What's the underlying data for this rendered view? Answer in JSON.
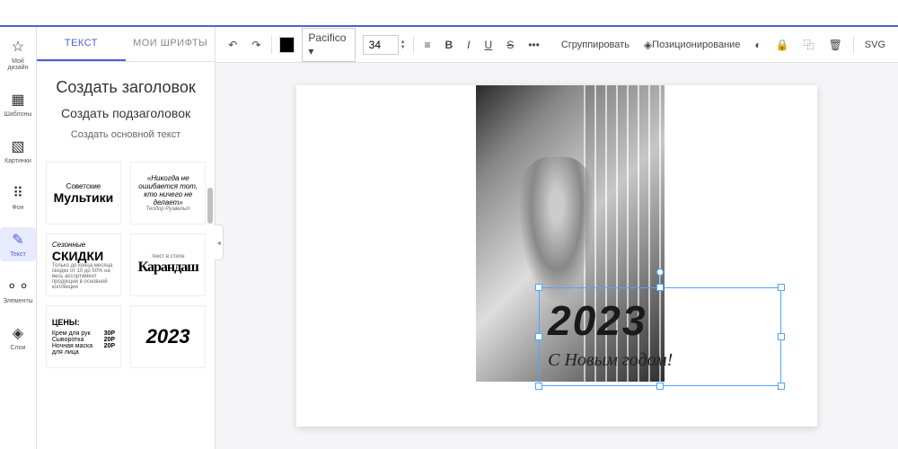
{
  "nav": [
    {
      "icon": "☆",
      "label": "Мой дизайн",
      "name": "nav-my-design"
    },
    {
      "icon": "▦",
      "label": "Шаблоны",
      "name": "nav-templates"
    },
    {
      "icon": "▧",
      "label": "Картинки",
      "name": "nav-images"
    },
    {
      "icon": "⠿",
      "label": "Фон",
      "name": "nav-background"
    },
    {
      "icon": "✎",
      "label": "Текст",
      "name": "nav-text",
      "active": true
    },
    {
      "icon": "⚬⚬",
      "label": "Элементы",
      "name": "nav-elements"
    },
    {
      "icon": "◈",
      "label": "Слои",
      "name": "nav-layers"
    }
  ],
  "tabs": {
    "text": "ТЕКСТ",
    "fonts": "МОИ ШРИФТЫ"
  },
  "textOptions": {
    "heading": "Создать заголовок",
    "subheading": "Создать подзаголовок",
    "body": "Создать основной текст"
  },
  "templates": {
    "cartoons": {
      "top": "Советские",
      "main": "Мультики"
    },
    "quote": {
      "text": "«Никогда не ошибается тот, кто ничего не делает»",
      "author": "Теодор Рузвельт"
    },
    "sales": {
      "top": "Сезонные",
      "main": "СКИДКИ",
      "sub": "Только до конца месяца скидки от 10 до 50% на весь ассортимент продукции в основной коллекции"
    },
    "pencil": {
      "top": "текст в стиле",
      "main": "Карандаш"
    },
    "prices": {
      "title": "ЦЕНЫ:",
      "items": [
        [
          "Крем для рук",
          "30P"
        ],
        [
          "Сыворотка",
          "20P"
        ],
        [
          "Ночная маска для лица",
          "20P"
        ]
      ]
    },
    "year": {
      "main": "2023"
    }
  },
  "toolbar": {
    "font": "Pacifico",
    "size": "34",
    "group": "Сгруппировать",
    "position": "Позиционирование",
    "svg": "SVG"
  },
  "canvas": {
    "year": "2023",
    "greeting": "С Новым годом!"
  }
}
